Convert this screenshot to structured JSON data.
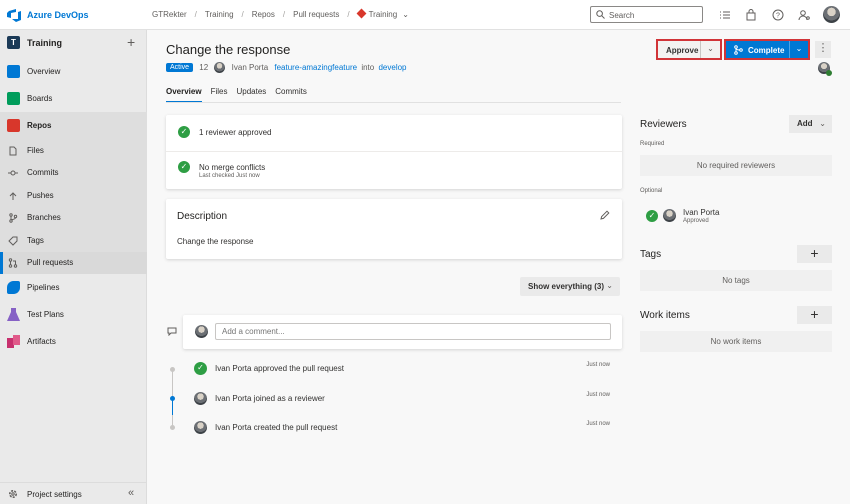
{
  "topbar": {
    "brand": "Azure DevOps",
    "breadcrumbs": [
      "GTRekter",
      "Training",
      "Repos",
      "Pull requests",
      "Training"
    ],
    "search_placeholder": "Search",
    "icons": [
      "list-icon",
      "shopping-bag-icon",
      "help-icon",
      "user-settings-icon"
    ]
  },
  "sidebar": {
    "project_initial": "T",
    "project_name": "Training",
    "items": [
      {
        "label": "Overview",
        "icon": "overview-icon",
        "color": "#0078d4"
      },
      {
        "label": "Boards",
        "icon": "boards-icon",
        "color": "#009c5b"
      },
      {
        "label": "Repos",
        "icon": "repos-icon",
        "color": "#d8372b"
      },
      {
        "label": "Files",
        "icon": "files-icon"
      },
      {
        "label": "Commits",
        "icon": "commits-icon"
      },
      {
        "label": "Pushes",
        "icon": "pushes-icon"
      },
      {
        "label": "Branches",
        "icon": "branches-icon"
      },
      {
        "label": "Tags",
        "icon": "tags-icon"
      },
      {
        "label": "Pull requests",
        "icon": "pull-requests-icon"
      },
      {
        "label": "Pipelines",
        "icon": "pipelines-icon",
        "color": "#0078d4"
      },
      {
        "label": "Test Plans",
        "icon": "test-plans-icon",
        "color": "#8661c5"
      },
      {
        "label": "Artifacts",
        "icon": "artifacts-icon",
        "color": "#c7306e"
      }
    ],
    "settings_label": "Project settings"
  },
  "pr": {
    "title": "Change the response",
    "status": "Active",
    "id": "12",
    "author": "Ivan Porta",
    "source_branch": "feature-amazingfeature",
    "into": "into",
    "target_branch": "develop",
    "tabs": [
      "Overview",
      "Files",
      "Updates",
      "Commits"
    ],
    "approve_label": "Approve",
    "complete_label": "Complete"
  },
  "status": {
    "reviewers": "1 reviewer approved",
    "merge": "No merge conflicts",
    "merge_sub": "Last checked Just now"
  },
  "description": {
    "title": "Description",
    "text": "Change the response"
  },
  "activity": {
    "filter_label": "Show everything (3)",
    "comment_placeholder": "Add a comment...",
    "events": [
      {
        "text": "Ivan Porta approved the pull request",
        "time": "Just now"
      },
      {
        "text": "Ivan Porta joined as a reviewer",
        "time": "Just now"
      },
      {
        "text": "Ivan Porta created the pull request",
        "time": "Just now"
      }
    ]
  },
  "reviewers": {
    "title": "Reviewers",
    "add_label": "Add",
    "required_label": "Required",
    "required_empty": "No required reviewers",
    "optional_label": "Optional",
    "optional_name": "Ivan Porta",
    "optional_vote": "Approved"
  },
  "tags": {
    "title": "Tags",
    "empty": "No tags"
  },
  "work_items": {
    "title": "Work items",
    "empty": "No work items"
  },
  "colors": {
    "accent": "#0078d4",
    "approve_border": "#d13438",
    "success": "#2e9e44"
  }
}
